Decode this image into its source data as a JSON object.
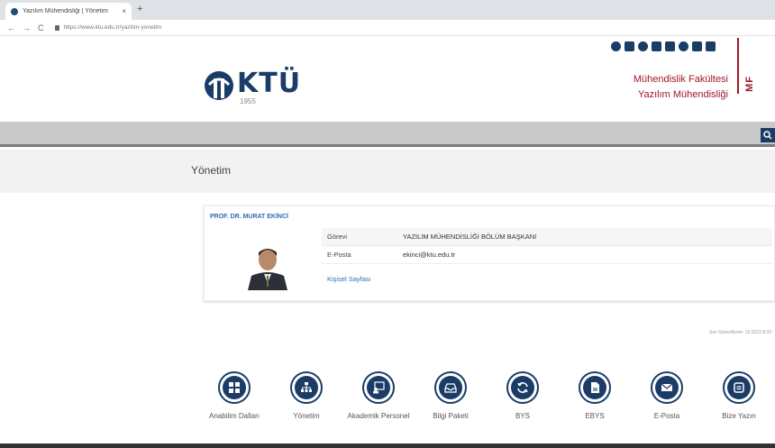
{
  "browser": {
    "tab_title": "Yazılım Mühendisliği | Yönetim",
    "tab_close": "×",
    "new_tab": "+",
    "url": "https://www.ktu.edu.tr/yazilim-yonetim",
    "back": "←",
    "forward": "→",
    "reload": "C"
  },
  "header": {
    "logo_text": "KTÜ",
    "logo_year": "1955",
    "faculty_line1": "Mühendislik Fakültesi",
    "faculty_line2": "Yazılım Mühendisliği",
    "faculty_badge": "MF",
    "social_icons": [
      "github-icon",
      "twitter-icon",
      "instagram-icon",
      "youtube-icon",
      "linkedin-icon",
      "microphone-icon",
      "tv-icon",
      "news-icon"
    ]
  },
  "page": {
    "title": "Yönetim",
    "last_updated": "Son Güncelleme: 10.2022 8:33"
  },
  "person": {
    "name": "PROF. DR. MURAT EKİNCİ",
    "rows": [
      {
        "key": "Görevi",
        "value": "YAZILIM MÜHENDİSLİĞİ BÖLÜM BAŞKANI"
      },
      {
        "key": "E-Posta",
        "value": "ekinci@ktu.edu.tr"
      }
    ],
    "personal_page": "Kişisel Sayfası"
  },
  "quick_links": [
    {
      "label": "Anabilim Dalları",
      "icon": "grid-icon"
    },
    {
      "label": "Yönetim",
      "icon": "sitemap-icon"
    },
    {
      "label": "Akademik Personel",
      "icon": "academic-staff-icon"
    },
    {
      "label": "Bilgi Paketi",
      "icon": "inbox-icon"
    },
    {
      "label": "BYS",
      "icon": "sync-icon"
    },
    {
      "label": "EBYS",
      "icon": "document-icon"
    },
    {
      "label": "E-Posta",
      "icon": "envelope-icon"
    },
    {
      "label": "Bize Yazın",
      "icon": "message-icon"
    }
  ],
  "colors": {
    "navy": "#1a3c66",
    "crimson": "#a0172b",
    "link": "#2a6db5"
  }
}
